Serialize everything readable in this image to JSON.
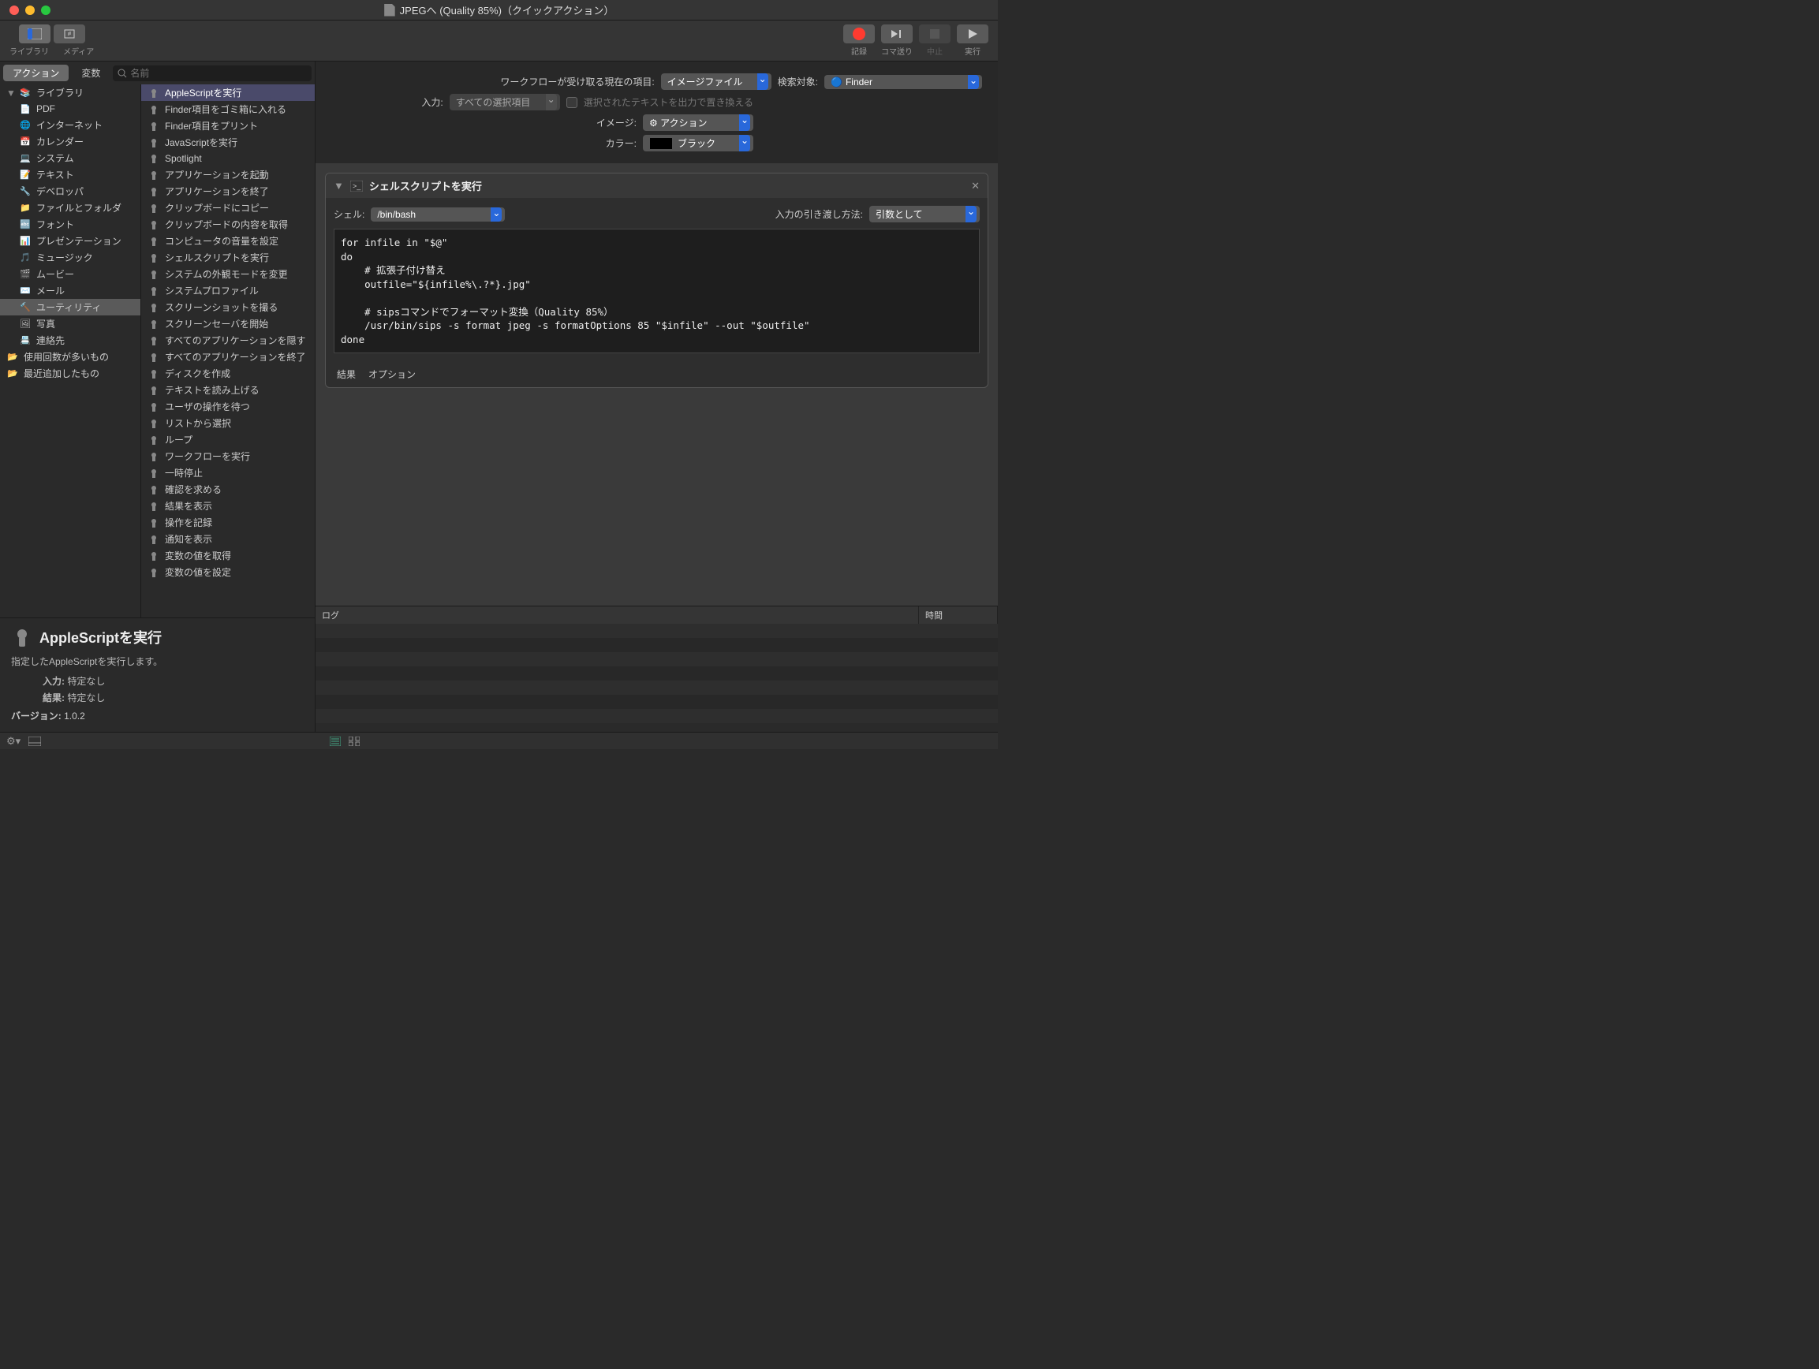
{
  "window": {
    "title": "JPEGへ (Quality 85%)（クイックアクション）"
  },
  "toolbar": {
    "library_label": "ライブラリ",
    "media_label": "メディア",
    "record_label": "記録",
    "step_label": "コマ送り",
    "stop_label": "中止",
    "run_label": "実行"
  },
  "tabs": {
    "action": "アクション",
    "variables": "変数"
  },
  "search": {
    "placeholder": "名前"
  },
  "categories": [
    {
      "label": "ライブラリ",
      "icon": "📚",
      "root": true
    },
    {
      "label": "PDF",
      "icon": "📄"
    },
    {
      "label": "インターネット",
      "icon": "🌐"
    },
    {
      "label": "カレンダー",
      "icon": "📅"
    },
    {
      "label": "システム",
      "icon": "💻"
    },
    {
      "label": "テキスト",
      "icon": "📝"
    },
    {
      "label": "デベロッパ",
      "icon": "🔧"
    },
    {
      "label": "ファイルとフォルダ",
      "icon": "📁"
    },
    {
      "label": "フォント",
      "icon": "🔤"
    },
    {
      "label": "プレゼンテーション",
      "icon": "📊"
    },
    {
      "label": "ミュージック",
      "icon": "🎵"
    },
    {
      "label": "ムービー",
      "icon": "🎬"
    },
    {
      "label": "メール",
      "icon": "✉️"
    },
    {
      "label": "ユーティリティ",
      "icon": "🔨",
      "selected": true
    },
    {
      "label": "写真",
      "icon": "🖼"
    },
    {
      "label": "連絡先",
      "icon": "📇"
    },
    {
      "label": "使用回数が多いもの",
      "icon": "📂",
      "root": true
    },
    {
      "label": "最近追加したもの",
      "icon": "📂",
      "root": true
    }
  ],
  "actions": [
    {
      "label": "AppleScriptを実行",
      "selected": true
    },
    {
      "label": "Finder項目をゴミ箱に入れる"
    },
    {
      "label": "Finder項目をプリント"
    },
    {
      "label": "JavaScriptを実行"
    },
    {
      "label": "Spotlight"
    },
    {
      "label": "アプリケーションを起動"
    },
    {
      "label": "アプリケーションを終了"
    },
    {
      "label": "クリップボードにコピー"
    },
    {
      "label": "クリップボードの内容を取得"
    },
    {
      "label": "コンピュータの音量を設定"
    },
    {
      "label": "シェルスクリプトを実行"
    },
    {
      "label": "システムの外観モードを変更"
    },
    {
      "label": "システムプロファイル"
    },
    {
      "label": "スクリーンショットを撮る"
    },
    {
      "label": "スクリーンセーバを開始"
    },
    {
      "label": "すべてのアプリケーションを隠す"
    },
    {
      "label": "すべてのアプリケーションを終了"
    },
    {
      "label": "ディスクを作成"
    },
    {
      "label": "テキストを読み上げる"
    },
    {
      "label": "ユーザの操作を待つ"
    },
    {
      "label": "リストから選択"
    },
    {
      "label": "ループ"
    },
    {
      "label": "ワークフローを実行"
    },
    {
      "label": "一時停止"
    },
    {
      "label": "確認を求める"
    },
    {
      "label": "結果を表示"
    },
    {
      "label": "操作を記録"
    },
    {
      "label": "通知を表示"
    },
    {
      "label": "変数の値を取得"
    },
    {
      "label": "変数の値を設定"
    }
  ],
  "info": {
    "title": "AppleScriptを実行",
    "desc": "指定したAppleScriptを実行します。",
    "input_label": "入力:",
    "input_value": "特定なし",
    "result_label": "結果:",
    "result_value": "特定なし",
    "version_label": "バージョン:",
    "version_value": "1.0.2"
  },
  "config": {
    "receives_label": "ワークフローが受け取る現在の項目:",
    "receives_value": "イメージファイル",
    "search_target_label": "検索対象:",
    "search_target_value": "Finder",
    "input_label": "入力:",
    "input_value": "すべての選択項目",
    "replace_text_label": "選択されたテキストを出力で置き換える",
    "image_label": "イメージ:",
    "image_value": "アクション",
    "color_label": "カラー:",
    "color_value": "ブラック"
  },
  "shell_action": {
    "title": "シェルスクリプトを実行",
    "shell_label": "シェル:",
    "shell_value": "/bin/bash",
    "pass_label": "入力の引き渡し方法:",
    "pass_value": "引数として",
    "code": "for infile in \"$@\"\ndo\n    # 拡張子付け替え\n    outfile=\"${infile%\\.?*}.jpg\"\n\n    # sipsコマンドでフォーマット変換（Quality 85%）\n    /usr/bin/sips -s format jpeg -s formatOptions 85 \"$infile\" --out \"$outfile\"\ndone",
    "results_tab": "結果",
    "options_tab": "オプション"
  },
  "log": {
    "col_log": "ログ",
    "col_time": "時間"
  }
}
